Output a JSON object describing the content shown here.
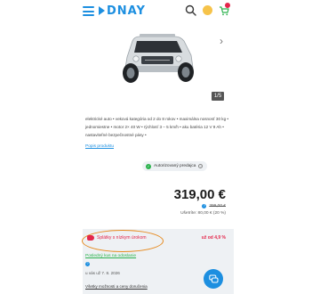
{
  "header": {
    "logo_text": "DNAY",
    "brand_color": "#1d8fe0",
    "icons": [
      "menu-icon",
      "search-icon",
      "smile-icon",
      "cart-icon"
    ]
  },
  "gallery": {
    "counter": "1/5",
    "next_glyph": "›"
  },
  "description": {
    "text": "elektrické auto • veková kategória od 2 do 8 rokov • maximálna nosnosť 30 kg • jednomiestne • motor 2× 40 W • rýchlosť 3 – 5 km/h • aku batéria 12 V 9 Ah • nastaviteľné bezpečnostné pásy •",
    "more_link": "Popis produktu"
  },
  "badge": {
    "label": "Autorizovaný predajca"
  },
  "price": {
    "current": "319,00 €",
    "old": "399,00 €",
    "savings": "Ušetríte: 80,00 € (20 %)"
  },
  "installments": {
    "label": "Splátky s nízkym úrokom",
    "rate": "už od 4,9 %"
  },
  "shipping": {
    "last_piece": "Posledný kus na odoslanie",
    "date": "u vás už 7. 8. 2026",
    "delivery_link": "Všetky možnosti a ceny doručenia"
  },
  "colors": {
    "accent": "#1d8fe0",
    "highlight": "#e4264b",
    "success": "#2bb24c",
    "annotation": "#e68a1f"
  }
}
